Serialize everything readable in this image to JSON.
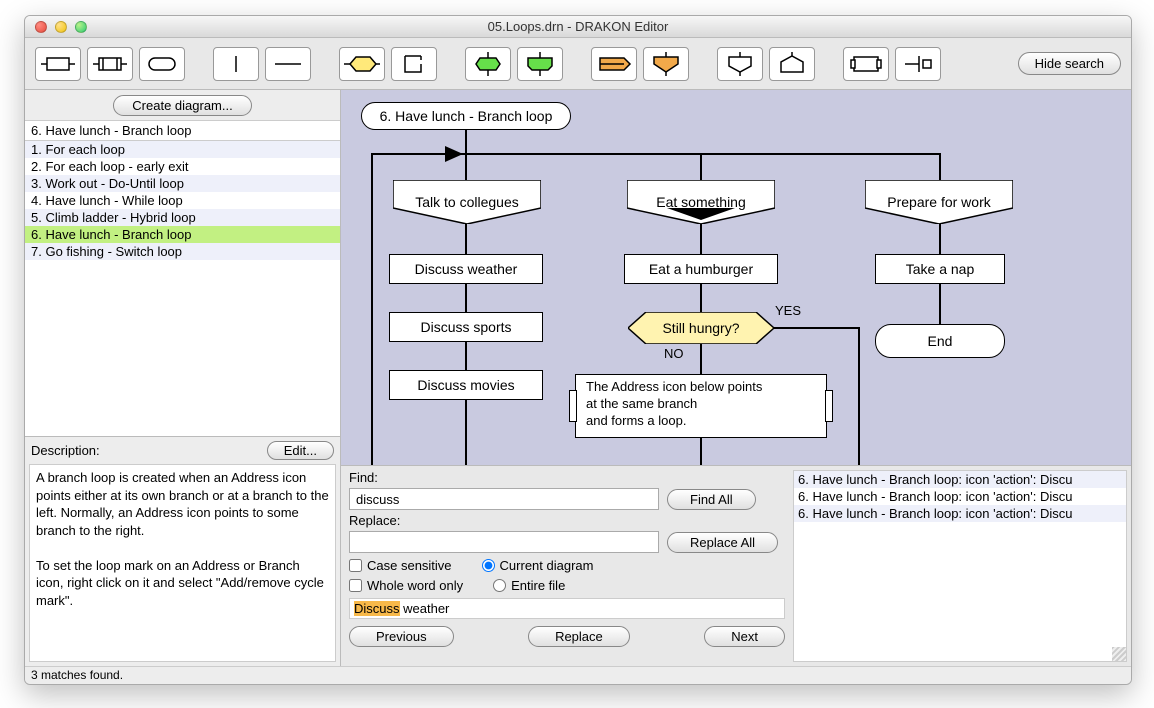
{
  "title": "05.Loops.drn - DRAKON Editor",
  "hide_search": "Hide search",
  "create_diagram": "Create diagram...",
  "filter_value": "6. Have lunch - Branch loop",
  "diagrams": [
    "1. For each loop",
    "2. For each loop - early exit",
    "3. Work out - Do-Until loop",
    "4. Have lunch - While loop",
    "5. Climb ladder - Hybrid loop",
    "6. Have lunch - Branch loop",
    "7. Go fishing - Switch loop"
  ],
  "description_label": "Description:",
  "edit_label": "Edit...",
  "description_text": "A branch loop is created when an Address icon points either at its own branch or at a branch to the left. Normally, an Address icon points to some branch to the right.\n\nTo set the loop mark on an Address or Branch icon, right click on it and select \"Add/remove cycle mark\".",
  "find_label": "Find:",
  "find_value": "discuss",
  "find_all": "Find All",
  "replace_label": "Replace:",
  "replace_value": "",
  "replace_all": "Replace All",
  "case_sensitive": "Case sensitive",
  "whole_word": "Whole word only",
  "current_diagram": "Current diagram",
  "entire_file": "Entire file",
  "preview_hl": "Discuss",
  "preview_rest": " weather",
  "prev": "Previous",
  "replace": "Replace",
  "next": "Next",
  "results": [
    "6. Have lunch - Branch loop: icon 'action': Discu",
    "6. Have lunch - Branch loop: icon 'action': Discu",
    "6. Have lunch - Branch loop: icon 'action': Discu"
  ],
  "status": "3 matches found.",
  "diagram": {
    "title": "6. Have lunch - Branch loop",
    "branch1": "Talk to collegues",
    "branch2": "Eat something",
    "branch3": "Prepare for work",
    "a1": "Discuss weather",
    "a2": "Discuss sports",
    "a3": "Discuss movies",
    "b1": "Eat a humburger",
    "q1": "Still hungry?",
    "yes": "YES",
    "no": "NO",
    "comment": "The Address icon below points\nat the same branch\nand forms a loop.",
    "c1": "Take a nap",
    "end": "End"
  }
}
